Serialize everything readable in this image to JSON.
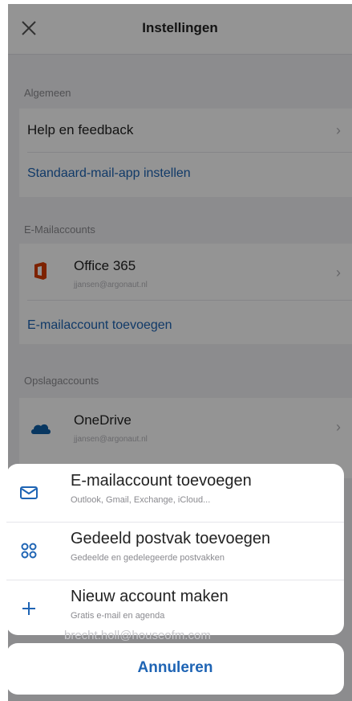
{
  "header": {
    "title": "Instellingen"
  },
  "general": {
    "label": "Algemeen",
    "help": "Help en feedback",
    "default_mail": "Standaard-mail-app instellen"
  },
  "mail_accounts": {
    "label": "E-Mailaccounts",
    "account_title": "Office 365",
    "account_email": "jjansen@argonaut.nl",
    "add": "E-mailaccount toevoegen"
  },
  "storage_accounts": {
    "label": "Opslagaccounts",
    "account_title": "OneDrive",
    "account_email": "jjansen@argonaut.nl"
  },
  "sheet": {
    "options": [
      {
        "title": "E-mailaccount toevoegen",
        "subtitle": "Outlook, Gmail, Exchange, iCloud..."
      },
      {
        "title": "Gedeeld postvak toevoegen",
        "subtitle": "Gedeelde en gedelegeerde postvakken"
      },
      {
        "title": "Nieuw account maken",
        "subtitle": "Gratis e-mail en agenda"
      }
    ],
    "cancel": "Annuleren"
  },
  "peek_text": "brecht.holl@houseofm.com",
  "colors": {
    "accent": "#1e64b4",
    "office": "#d83b01",
    "onedrive": "#0f5fa8"
  }
}
